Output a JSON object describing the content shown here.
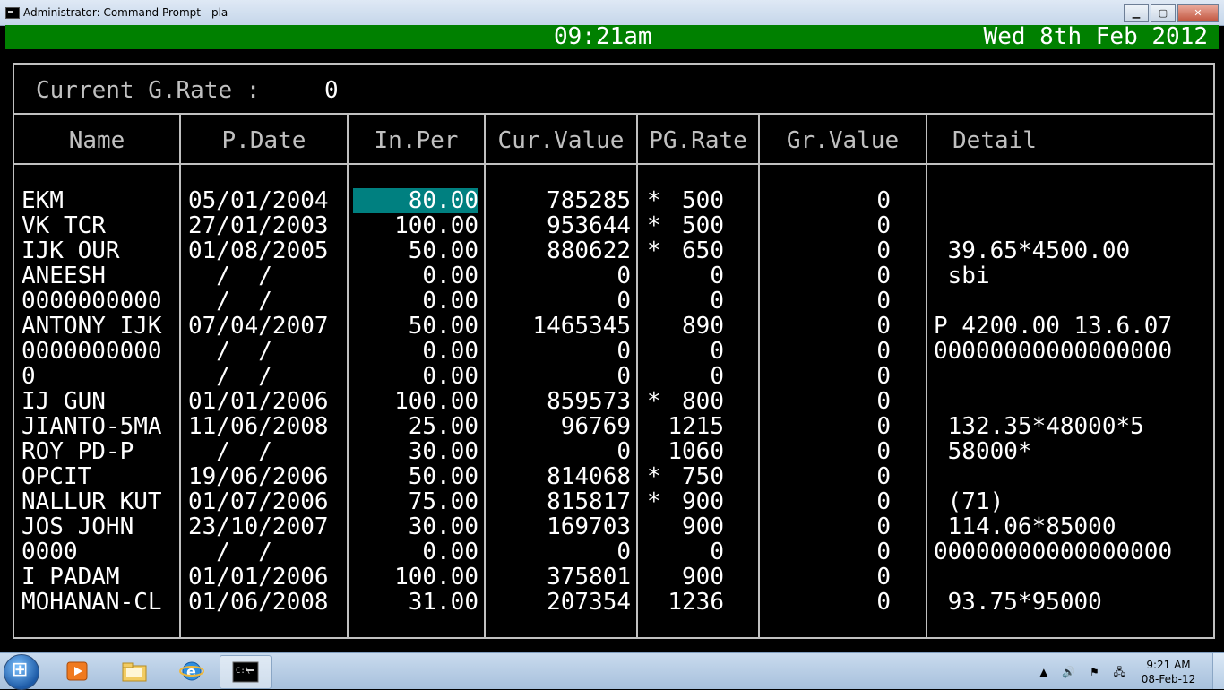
{
  "window": {
    "title": "Administrator: Command Prompt - pla",
    "minimize_label": "▁",
    "maximize_label": "▢",
    "close_label": "✕"
  },
  "status": {
    "time": "09:21am",
    "date": "Wed 8th Feb 2012"
  },
  "rate": {
    "label": "Current G.Rate :",
    "value": "0"
  },
  "columns": [
    "Name",
    "P.Date",
    "In.Per",
    "Cur.Value",
    "PG.Rate",
    "Gr.Value",
    "Detail"
  ],
  "rows": [
    {
      "name": "EKM",
      "pdate": "05/01/2004",
      "inper": "80.00",
      "curvalue": "785285",
      "pgrate": "* 500",
      "grvalue": "0",
      "detail": ""
    },
    {
      "name": "VK TCR",
      "pdate": "27/01/2003",
      "inper": "100.00",
      "curvalue": "953644",
      "pgrate": "* 500",
      "grvalue": "0",
      "detail": ""
    },
    {
      "name": "IJK OUR",
      "pdate": "01/08/2005",
      "inper": "50.00",
      "curvalue": "880622",
      "pgrate": "* 650",
      "grvalue": "0",
      "detail": " 39.65*4500.00"
    },
    {
      "name": "ANEESH",
      "pdate": "  /  /",
      "inper": "0.00",
      "curvalue": "0",
      "pgrate": "0",
      "grvalue": "0",
      "detail": " sbi"
    },
    {
      "name": "0000000000",
      "pdate": "  /  /",
      "inper": "0.00",
      "curvalue": "0",
      "pgrate": "0",
      "grvalue": "0",
      "detail": ""
    },
    {
      "name": "ANTONY IJK",
      "pdate": "07/04/2007",
      "inper": "50.00",
      "curvalue": "1465345",
      "pgrate": "890",
      "grvalue": "0",
      "detail": "P 4200.00 13.6.07"
    },
    {
      "name": "0000000000",
      "pdate": "  /  /",
      "inper": "0.00",
      "curvalue": "0",
      "pgrate": "0",
      "grvalue": "0",
      "detail": "00000000000000000"
    },
    {
      "name": "0",
      "pdate": "  /  /",
      "inper": "0.00",
      "curvalue": "0",
      "pgrate": "0",
      "grvalue": "0",
      "detail": ""
    },
    {
      "name": "IJ GUN",
      "pdate": "01/01/2006",
      "inper": "100.00",
      "curvalue": "859573",
      "pgrate": "* 800",
      "grvalue": "0",
      "detail": ""
    },
    {
      "name": "JIANTO-5MA",
      "pdate": "11/06/2008",
      "inper": "25.00",
      "curvalue": "96769",
      "pgrate": "1215",
      "grvalue": "0",
      "detail": " 132.35*48000*5"
    },
    {
      "name": "ROY PD-P",
      "pdate": "  /  /",
      "inper": "30.00",
      "curvalue": "0",
      "pgrate": "1060",
      "grvalue": "0",
      "detail": " 58000*"
    },
    {
      "name": "OPCIT",
      "pdate": "19/06/2006",
      "inper": "50.00",
      "curvalue": "814068",
      "pgrate": "* 750",
      "grvalue": "0",
      "detail": ""
    },
    {
      "name": "NALLUR KUT",
      "pdate": "01/07/2006",
      "inper": "75.00",
      "curvalue": "815817",
      "pgrate": "* 900",
      "grvalue": "0",
      "detail": " (71)"
    },
    {
      "name": "JOS JOHN",
      "pdate": "23/10/2007",
      "inper": "30.00",
      "curvalue": "169703",
      "pgrate": "900",
      "grvalue": "0",
      "detail": " 114.06*85000"
    },
    {
      "name": "0000",
      "pdate": "  /  /",
      "inper": "0.00",
      "curvalue": "0",
      "pgrate": "0",
      "grvalue": "0",
      "detail": "00000000000000000"
    },
    {
      "name": "I PADAM",
      "pdate": "01/01/2006",
      "inper": "100.00",
      "curvalue": "375801",
      "pgrate": "900",
      "grvalue": "0",
      "detail": ""
    },
    {
      "name": "MOHANAN-CL",
      "pdate": "01/06/2008",
      "inper": "31.00",
      "curvalue": "207354",
      "pgrate": "1236",
      "grvalue": "0",
      "detail": " 93.75*95000"
    }
  ],
  "colors": {
    "status_bar": "#008000",
    "selection": "#008080",
    "console_bg": "#000000",
    "text": "#ffffff",
    "frame": "#c0c0c0"
  },
  "taskbar": {
    "icons": [
      "start-icon",
      "media-player-icon",
      "file-explorer-icon",
      "internet-explorer-icon",
      "command-prompt-icon"
    ],
    "tray_icons": "▲ 🔊 ⚑ 🖧",
    "clock_time": "9:21 AM",
    "clock_date": "08-Feb-12"
  }
}
